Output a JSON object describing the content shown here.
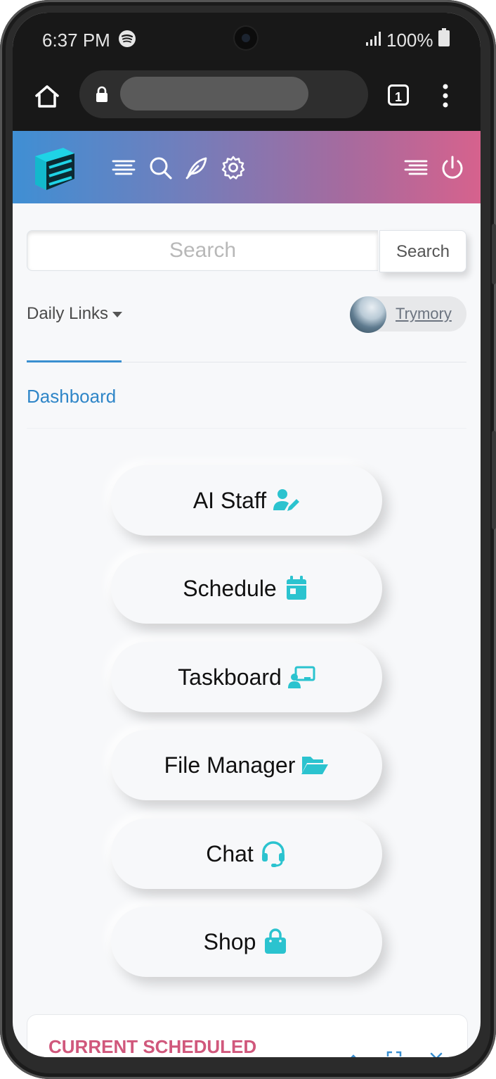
{
  "status_bar": {
    "time": "6:37 PM",
    "battery": "100%",
    "icons": [
      "spotify-icon",
      "signal-icon",
      "battery-icon"
    ]
  },
  "browser": {
    "tab_count": "1",
    "icons": [
      "home-icon",
      "lock-icon",
      "more-vert-icon"
    ]
  },
  "header": {
    "icons": [
      "logo",
      "menu-lines-icon",
      "search-icon",
      "feather-icon",
      "gear-icon",
      "list-icon",
      "power-icon"
    ],
    "gradient": [
      "#3f8fd4",
      "#d6628d"
    ]
  },
  "search": {
    "placeholder": "Search",
    "button_label": "Search"
  },
  "daily_links": {
    "label": "Daily Links"
  },
  "user": {
    "name": "Trymory"
  },
  "nav": {
    "active_tab": "Dashboard"
  },
  "menu": {
    "items": [
      {
        "label": "AI Staff",
        "icon": "user-edit-icon"
      },
      {
        "label": "Schedule",
        "icon": "calendar-icon"
      },
      {
        "label": "Taskboard",
        "icon": "chalkboard-user-icon"
      },
      {
        "label": "File Manager",
        "icon": "folder-open-icon"
      },
      {
        "label": "Chat",
        "icon": "headset-icon"
      },
      {
        "label": "Shop",
        "icon": "shopping-bag-icon"
      }
    ],
    "icon_color": "#2bc3cf"
  },
  "card": {
    "title": "CURRENT SCHEDULED",
    "title_color": "#d0587c",
    "controls": [
      "chevron-up-icon",
      "expand-icon",
      "close-icon"
    ]
  }
}
